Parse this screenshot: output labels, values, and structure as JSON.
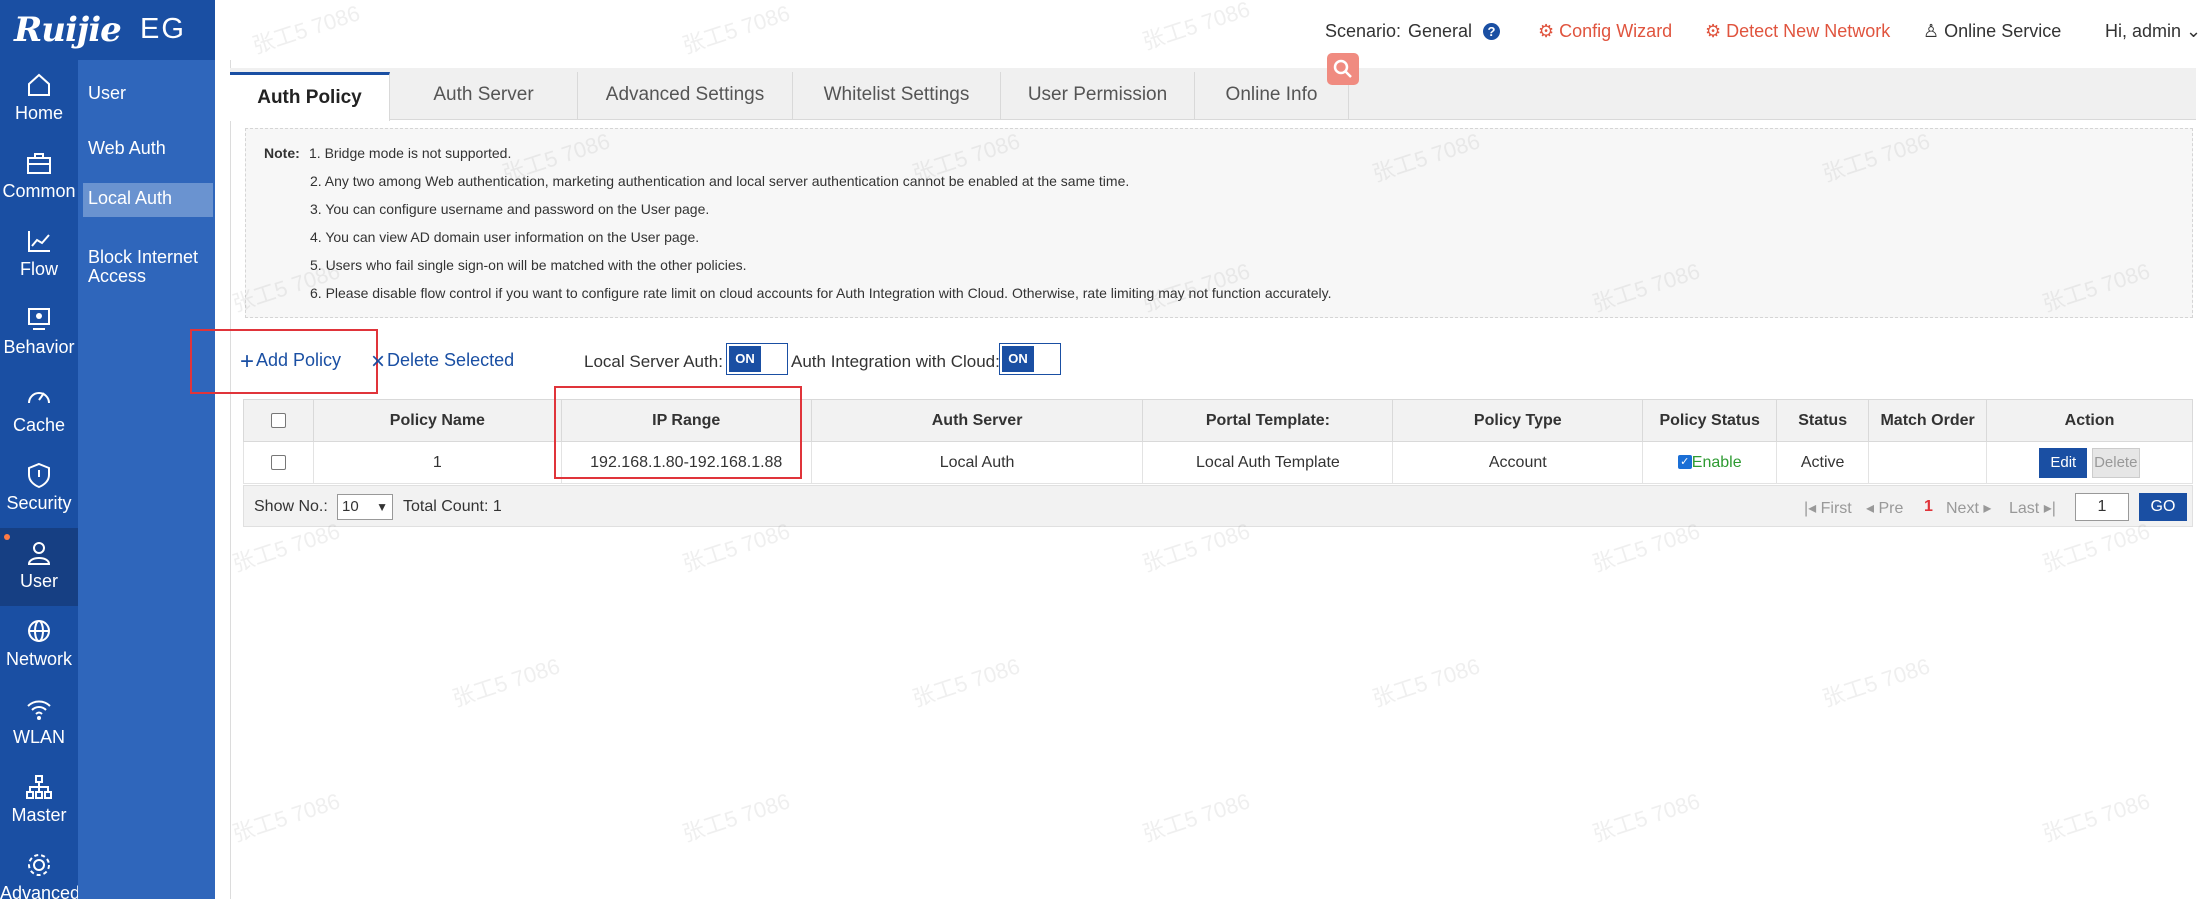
{
  "brand": {
    "logo": "Ruijie",
    "product": "EG"
  },
  "rail": [
    {
      "key": "home",
      "label": "Home",
      "icon": "home-icon"
    },
    {
      "key": "common",
      "label": "Common",
      "icon": "toolbox-icon"
    },
    {
      "key": "flow",
      "label": "Flow",
      "icon": "line-chart-icon"
    },
    {
      "key": "behavior",
      "label": "Behavior",
      "icon": "behavior-icon"
    },
    {
      "key": "cache",
      "label": "Cache",
      "icon": "gauge-icon"
    },
    {
      "key": "security",
      "label": "Security",
      "icon": "shield-icon"
    },
    {
      "key": "user",
      "label": "User",
      "icon": "user-icon",
      "active": true
    },
    {
      "key": "network",
      "label": "Network",
      "icon": "globe-icon"
    },
    {
      "key": "wlan",
      "label": "WLAN",
      "icon": "wifi-icon"
    },
    {
      "key": "master",
      "label": "Master",
      "icon": "hierarchy-icon"
    },
    {
      "key": "advanced",
      "label": "Advanced",
      "icon": "gear-icon"
    }
  ],
  "submenu": [
    {
      "label": "User"
    },
    {
      "label": "Web Auth"
    },
    {
      "label": "Local Auth",
      "active": true
    },
    {
      "label": "Block Internet Access"
    }
  ],
  "header": {
    "scenario_label": "Scenario:",
    "scenario_value": "General",
    "config_wizard": "Config Wizard",
    "detect_network": "Detect New Network",
    "online_service": "Online Service",
    "greeting": "Hi, admin"
  },
  "tabs": [
    {
      "label": "Auth Policy",
      "active": true
    },
    {
      "label": "Auth Server"
    },
    {
      "label": "Advanced Settings"
    },
    {
      "label": "Whitelist Settings"
    },
    {
      "label": "User Permission"
    },
    {
      "label": "Online Info"
    }
  ],
  "notes": {
    "label": "Note:",
    "lines": [
      "1. Bridge mode is not supported.",
      "2. Any two among Web authentication, marketing authentication and local server authentication cannot be enabled at the same time.",
      "3. You can configure username and password on the User page.",
      "4. You can view AD domain user information on the User page.",
      "5. Users who fail single sign-on will be matched with the other policies.",
      "6. Please disable flow control if you want to configure rate limit on cloud accounts for Auth Integration with Cloud. Otherwise, rate limiting may not function accurately."
    ]
  },
  "toolbar": {
    "add_policy": "Add Policy",
    "delete_selected": "Delete Selected",
    "local_server_auth_label": "Local Server Auth:",
    "local_server_auth_state": "ON",
    "cloud_auth_label": "Auth Integration with Cloud:",
    "cloud_auth_state": "ON"
  },
  "table": {
    "columns": [
      "Policy Name",
      "IP Range",
      "Auth Server",
      "Portal Template:",
      "Policy Type",
      "Policy Status",
      "Status",
      "Match Order",
      "Action"
    ],
    "rows": [
      {
        "policy_name": "1",
        "ip_range": "192.168.1.80-192.168.1.88",
        "auth_server": "Local Auth",
        "portal_template": "Local Auth Template",
        "policy_type": "Account",
        "policy_status": "Enable",
        "status": "Active",
        "match_order": "",
        "edit": "Edit",
        "delete": "Delete"
      }
    ]
  },
  "pager": {
    "show_no_label": "Show No.:",
    "show_no_value": "10",
    "total_count": "Total Count: 1",
    "first": "First",
    "prev": "Pre",
    "current": "1",
    "next": "Next",
    "last": "Last",
    "page_input": "1",
    "go": "GO"
  },
  "watermark": "张工5 7086",
  "colors": {
    "brand_blue": "#1a4fa3",
    "submenu_blue": "#2f66bb",
    "accent_red": "#e0543e",
    "enable_green": "#2e9b32"
  }
}
